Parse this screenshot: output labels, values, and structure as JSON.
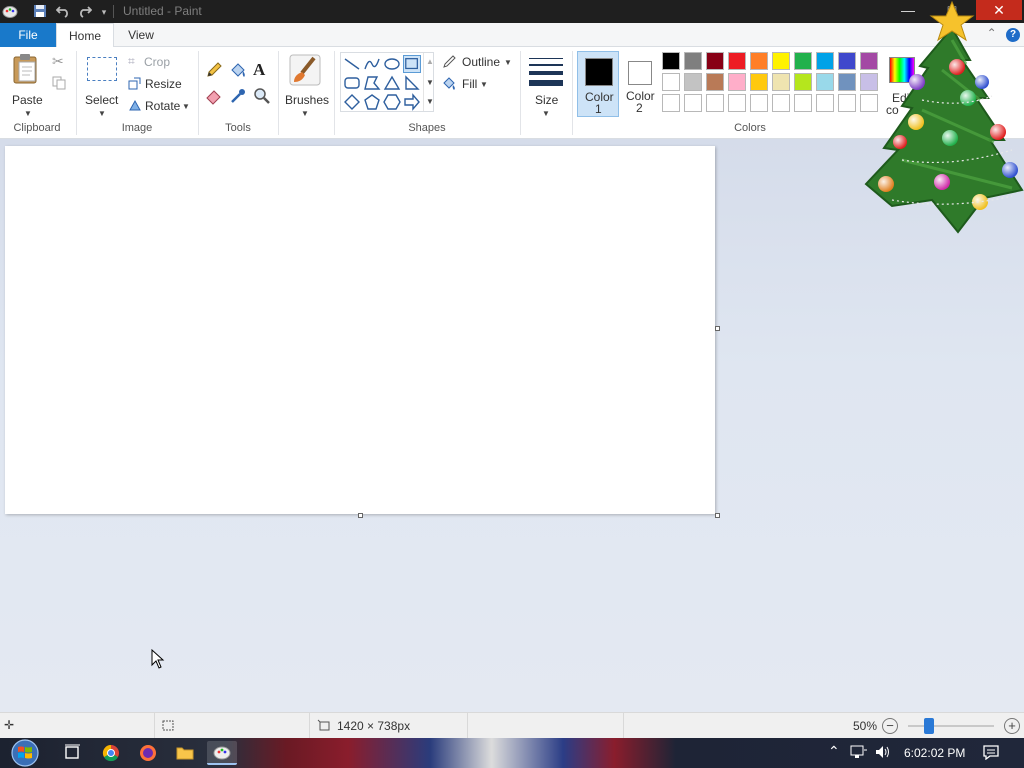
{
  "window": {
    "title": "Untitled - Paint",
    "minimize_glyph": "—",
    "maximize_glyph": "□",
    "close_glyph": "✕"
  },
  "tabs": {
    "file": "File",
    "home": "Home",
    "view": "View"
  },
  "ribbon": {
    "clipboard": {
      "label": "Clipboard",
      "paste": "Paste"
    },
    "image": {
      "label": "Image",
      "select": "Select",
      "crop": "Crop",
      "resize": "Resize",
      "rotate": "Rotate"
    },
    "tools": {
      "label": "Tools"
    },
    "brushes": {
      "label": "Brushes"
    },
    "shapes": {
      "label": "Shapes",
      "outline": "Outline",
      "fill": "Fill"
    },
    "size": {
      "label": "Size"
    },
    "colors": {
      "label": "Colors",
      "color1_line1": "Color",
      "color1_line2": "1",
      "color2_line1": "Color",
      "color2_line2": "2",
      "edit_colors_line1": "Edit",
      "edit_colors_line2": "co",
      "color1": "#000000",
      "color2": "#ffffff",
      "palette_row1": [
        "#000000",
        "#7f7f7f",
        "#880015",
        "#ed1c24",
        "#ff7f27",
        "#fff200",
        "#22b14c",
        "#00a2e8",
        "#3f48cc",
        "#a349a4"
      ],
      "palette_row2": [
        "#ffffff",
        "#c3c3c3",
        "#b97a57",
        "#ffaec9",
        "#ffc90e",
        "#efe4b0",
        "#b5e61d",
        "#99d9ea",
        "#7092be",
        "#c8bfe7"
      ],
      "palette_row3": [
        "#ffffff",
        "#ffffff",
        "#ffffff",
        "#ffffff",
        "#ffffff",
        "#ffffff",
        "#ffffff",
        "#ffffff",
        "#ffffff",
        "#ffffff"
      ]
    }
  },
  "status": {
    "canvas_size": "1420 × 738px",
    "zoom": "50%",
    "zoom_percent": 50
  },
  "taskbar": {
    "time": "6:02:02 PM"
  }
}
